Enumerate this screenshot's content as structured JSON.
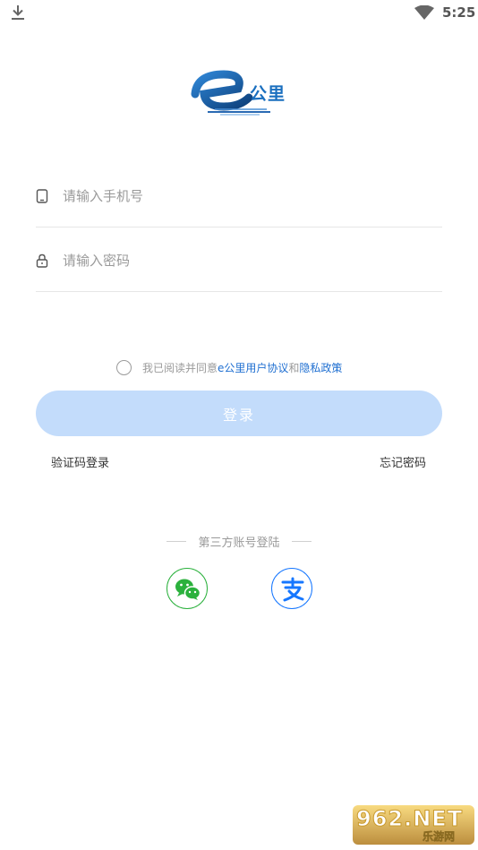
{
  "status_bar": {
    "time": "5:25"
  },
  "brand": {
    "logo_text": "公里"
  },
  "form": {
    "phone_placeholder": "请输入手机号",
    "password_placeholder": "请输入密码"
  },
  "agreement": {
    "prefix": "我已阅读并同意",
    "user_agreement": "e公里用户协议",
    "and": "和",
    "privacy_policy": "隐私政策"
  },
  "login_button": "登录",
  "sms_login": "验证码登录",
  "forgot_password": "忘记密码",
  "third_party": {
    "title": "第三方账号登陆",
    "providers": [
      "wechat-icon",
      "alipay-icon"
    ]
  },
  "watermark": {
    "main": "962.NET",
    "sub": "乐游网"
  },
  "colors": {
    "accent": "#1f6fd1",
    "login_button_bg": "#c3dcfb",
    "wechat": "#2bb13d",
    "alipay": "#1677ff"
  }
}
